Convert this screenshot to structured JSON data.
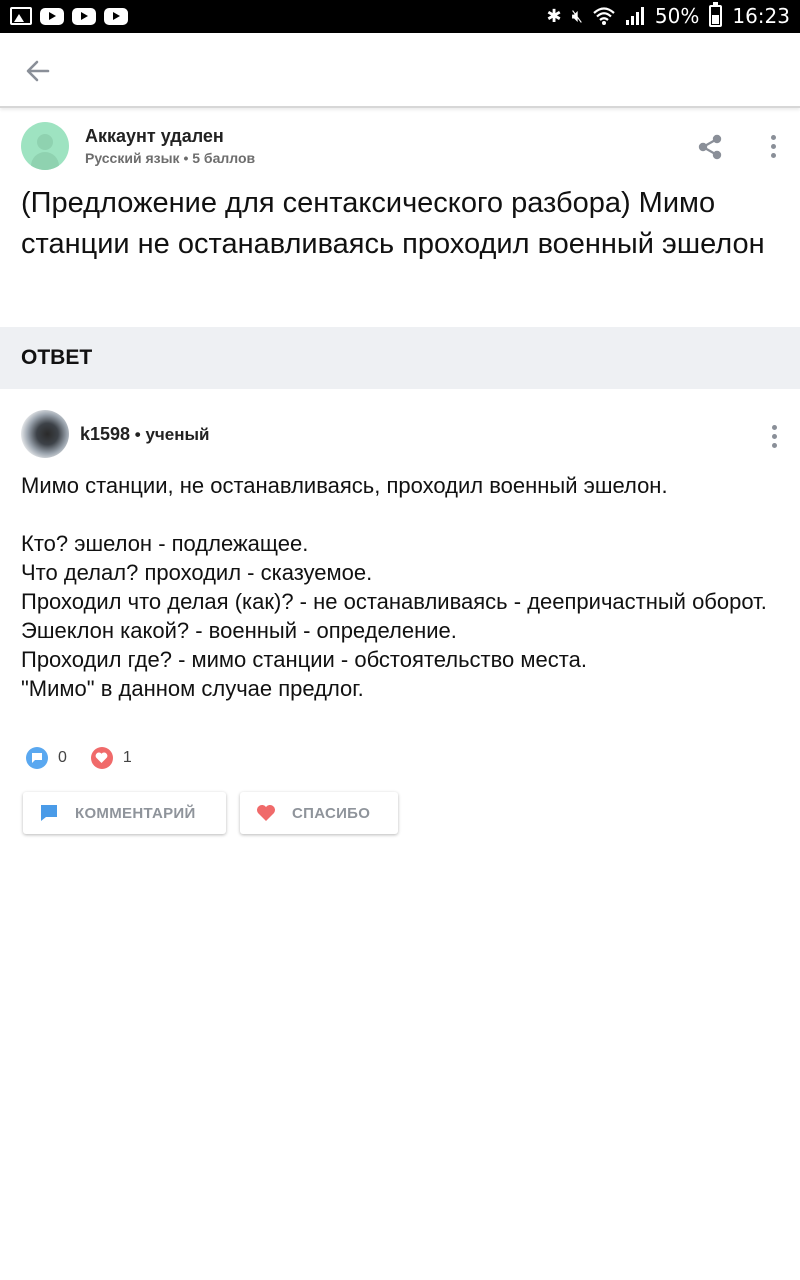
{
  "status_bar": {
    "battery": "50%",
    "time": "16:23"
  },
  "app_bar": {
    "back_icon": "arrow-left-icon"
  },
  "question": {
    "author": "Аккаунт удален",
    "subject": "Русский язык",
    "points": "5 баллов",
    "meta_separator": " • ",
    "text": "(Предложение для сентаксического разбора) Мимо станции не останавливаясь проходил военный эшелон"
  },
  "answer_section": {
    "title": "ОТВЕТ"
  },
  "answer": {
    "username": "k1598",
    "rank": "ученый",
    "lines": [
      "Мимо станции, не останавливаясь, проходил военный эшелон.",
      "",
      "Кто? эшелон - подлежащее.",
      "Что делал?  проходил - сказуемое.",
      "Проходил что делая (как)? - не останавливаясь - деепричастный оборот.",
      "Эшеклон какой? - военный - определение.",
      "Проходил где? - мимо станции - обстоятельство места.",
      "\"Мимо\" в данном случае предлог."
    ],
    "comments_count": "0",
    "likes_count": "1"
  },
  "actions": {
    "comment_label": "КОММЕНТАРИЙ",
    "thanks_label": "СПАСИБО"
  },
  "colors": {
    "accent_blue": "#5aa8f0",
    "accent_red": "#f06a6a",
    "section_bg": "#eef0f3"
  }
}
